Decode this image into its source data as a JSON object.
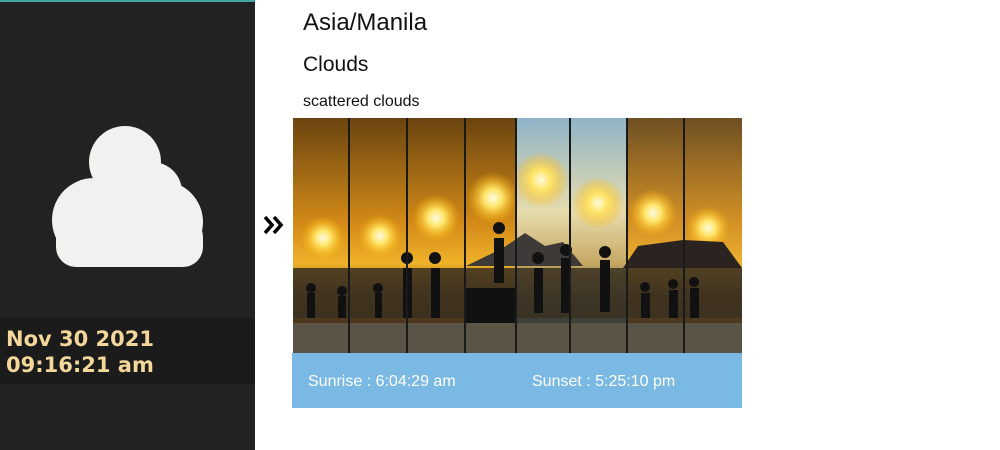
{
  "location": {
    "timezone": "Asia/Manila"
  },
  "weather": {
    "main": "Clouds",
    "description": "scattered clouds",
    "icon": "cloud-icon"
  },
  "datetime": {
    "text": "Nov 30 2021 09:16:21 am"
  },
  "navigation": {
    "icon": "double-chevron-right-icon"
  },
  "sun_times": {
    "sunrise": "Sunrise : 6:04:29 am",
    "sunset": "Sunset : 5:25:10 pm"
  },
  "colors": {
    "sidebar_bg": "#222222",
    "datetime_text": "#f4d79a",
    "accent_top_border": "#3fa7a3",
    "sun_bar_bg": "#79b9e3",
    "cloud": "#f1f1ef"
  }
}
